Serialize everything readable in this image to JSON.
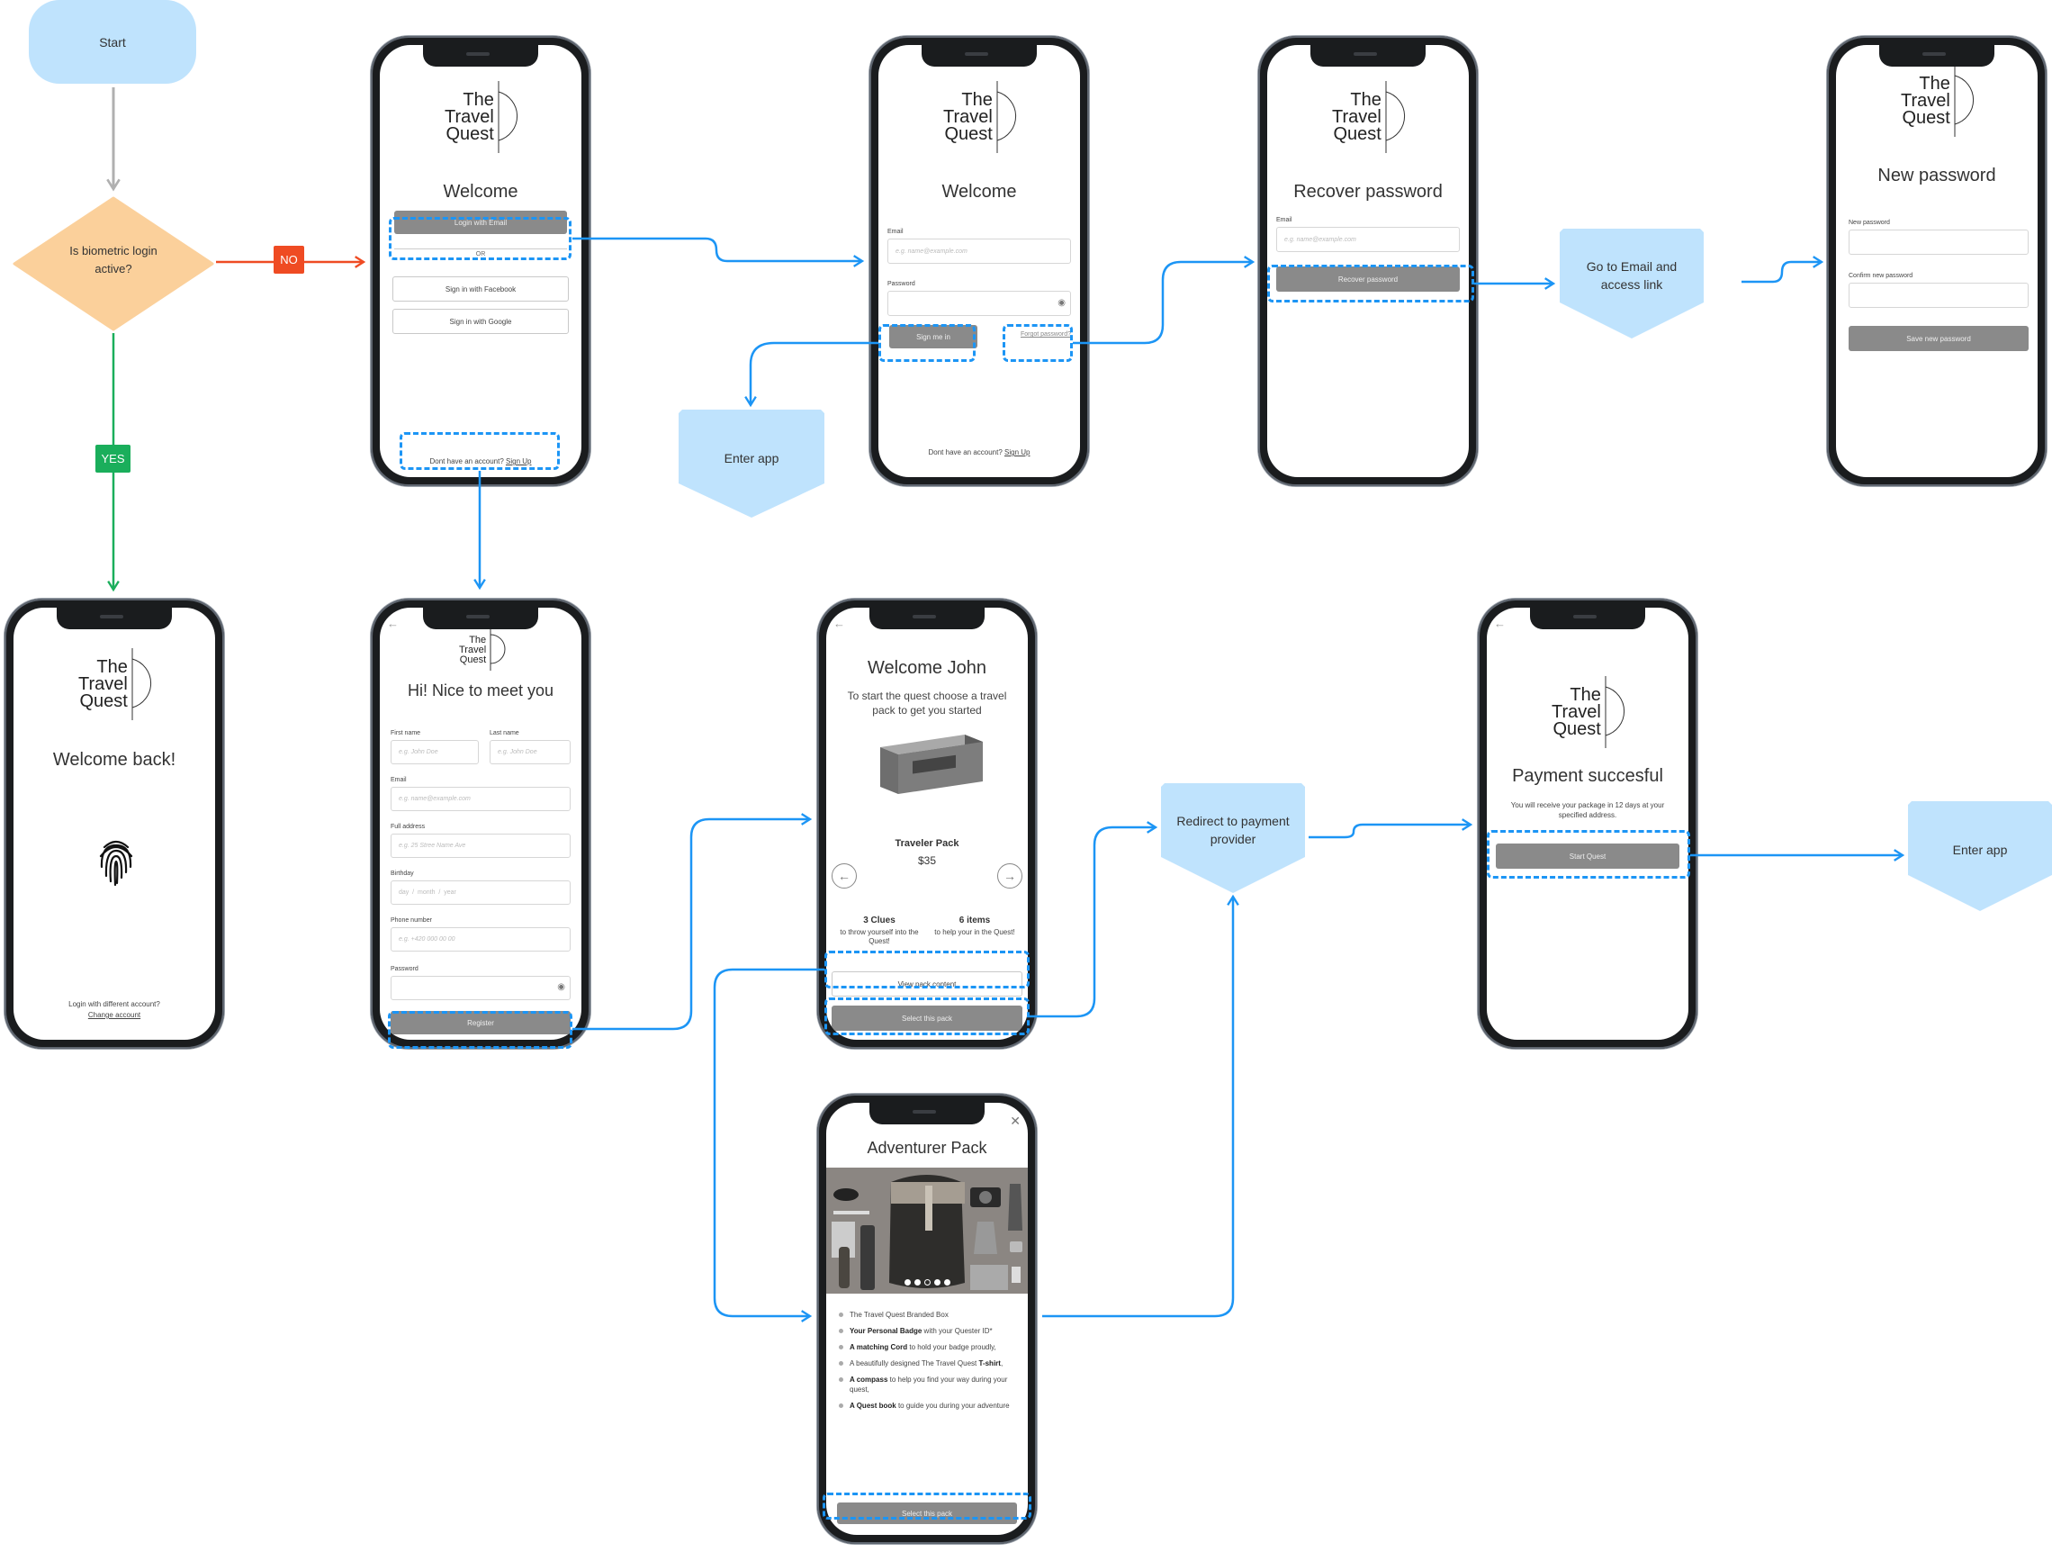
{
  "colors": {
    "start_fill": "#bfe3fd",
    "decision_fill": "#fbd09b",
    "no_color": "#ef4b23",
    "yes_color": "#1aae5b",
    "flow_color": "#1c95f5",
    "start_arrow": "#b0b0b0",
    "button_gray": "#8a8a8a"
  },
  "flow": {
    "start": "Start",
    "decision": "Is biometric login active?",
    "no_label": "NO",
    "yes_label": "YES",
    "enter_app_1": "Enter app",
    "go_to_email": "Go to Email and access link",
    "redirect_payment": "Redirect to payment provider",
    "enter_app_2": "Enter app"
  },
  "brand": {
    "line1": "The",
    "line2": "Travel",
    "line3": "Quest"
  },
  "screens": {
    "login": {
      "title": "Welcome",
      "login_email": "Login with Email",
      "or": "OR",
      "facebook": "Sign in with Facebook",
      "google": "Sign in with Google",
      "no_account": "Dont have an account?",
      "sign_up": "Sign Up"
    },
    "signin_email": {
      "title": "Welcome",
      "email_label": "Email",
      "email_placeholder": "e.g. name@example.com",
      "password_label": "Password",
      "sign_me_in": "Sign me in",
      "forgot": "Forgot password?",
      "no_account": "Dont have an account?",
      "sign_up": "Sign Up"
    },
    "recover": {
      "title": "Recover password",
      "email_label": "Email",
      "email_placeholder": "e.g. name@example.com",
      "button": "Recover password"
    },
    "new_password": {
      "title": "New password",
      "new_label": "New password",
      "confirm_label": "Confirm new password",
      "button": "Save new password"
    },
    "welcome_back": {
      "title": "Welcome back!",
      "different": "Login with different account?",
      "change": "Change account"
    },
    "register": {
      "title": "Hi! Nice to meet you",
      "first_name_label": "First name",
      "first_name_placeholder": "e.g. John Doe",
      "last_name_label": "Last name",
      "last_name_placeholder": "e.g. John Doe",
      "email_label": "Email",
      "email_placeholder": "e.g. name@example.com",
      "address_label": "Full address",
      "address_placeholder": "e.g. 25 Stree Name Ave",
      "birthday_label": "Birthday",
      "birthday_placeholder": "day  /  month  /  year",
      "phone_label": "Phone number",
      "phone_placeholder": "e.g. +420 000 00 00",
      "password_label": "Password",
      "button": "Register"
    },
    "choose_pack": {
      "title": "Welcome John",
      "subtitle": "To start the quest choose a travel pack to get you started",
      "pack_name": "Traveler Pack",
      "price": "$35",
      "stat1_title": "3 Clues",
      "stat1_text": "to throw yourself into the Quest!",
      "stat2_title": "6 items",
      "stat2_text": "to help your in the Quest!",
      "view_content": "View pack content",
      "select": "Select this pack"
    },
    "pack_detail": {
      "title": "Adventurer Pack",
      "carousel_count": 5,
      "carousel_active": 3,
      "items": [
        {
          "bold": "",
          "text": "The Travel Quest Branded Box"
        },
        {
          "bold": "Your Personal Badge",
          "text": " with your Quester ID*"
        },
        {
          "bold": "A matching Cord",
          "text": " to hold your badge proudly,"
        },
        {
          "bold": "",
          "text": "A beautifully designed The Travel Quest ",
          "bold_end": "T-shirt",
          "tail": ","
        },
        {
          "bold": "A compass",
          "text": " to help you find your way during your quest,"
        },
        {
          "bold": "A Quest book",
          "text": " to guide you during your adventure"
        }
      ],
      "select": "Select this pack"
    },
    "payment": {
      "title": "Payment succesful",
      "text": "You will receive your package in 12 days at your specified address.",
      "button": "Start Quest"
    }
  }
}
